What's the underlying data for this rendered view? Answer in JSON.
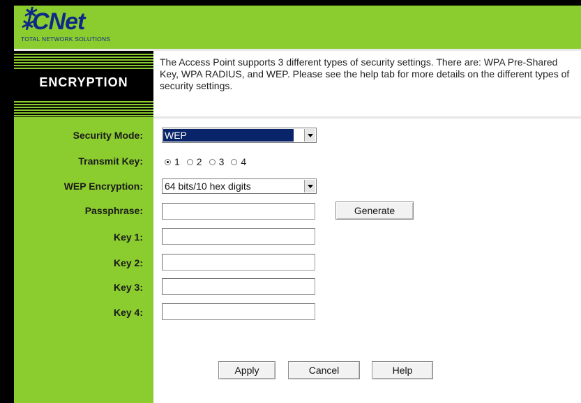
{
  "brand": {
    "logo_text": "CNet",
    "tagline": "TOTAL NETWORK SOLUTIONS"
  },
  "section": {
    "title": "ENCRYPTION"
  },
  "description": "The Access Point supports 3 different types of security settings. There are: WPA Pre-Shared Key, WPA RADIUS, and WEP. Please see the help tab for more details on the different types of security settings.",
  "form": {
    "security_mode": {
      "label": "Security Mode:",
      "value": "WEP"
    },
    "transmit_key": {
      "label": "Transmit Key:",
      "options": [
        "1",
        "2",
        "3",
        "4"
      ],
      "selected": "1"
    },
    "wep_encryption": {
      "label": "WEP Encryption:",
      "value": "64 bits/10 hex digits"
    },
    "passphrase": {
      "label": "Passphrase:",
      "value": "",
      "generate_label": "Generate"
    },
    "keys": [
      {
        "label": "Key 1:",
        "value": ""
      },
      {
        "label": "Key 2:",
        "value": ""
      },
      {
        "label": "Key 3:",
        "value": ""
      },
      {
        "label": "Key 4:",
        "value": ""
      }
    ]
  },
  "buttons": {
    "apply": "Apply",
    "cancel": "Cancel",
    "help": "Help"
  },
  "colors": {
    "header_green": "#8bcc2f",
    "selected_blue": "#0a246a",
    "logo_blue": "#0d2b86"
  }
}
